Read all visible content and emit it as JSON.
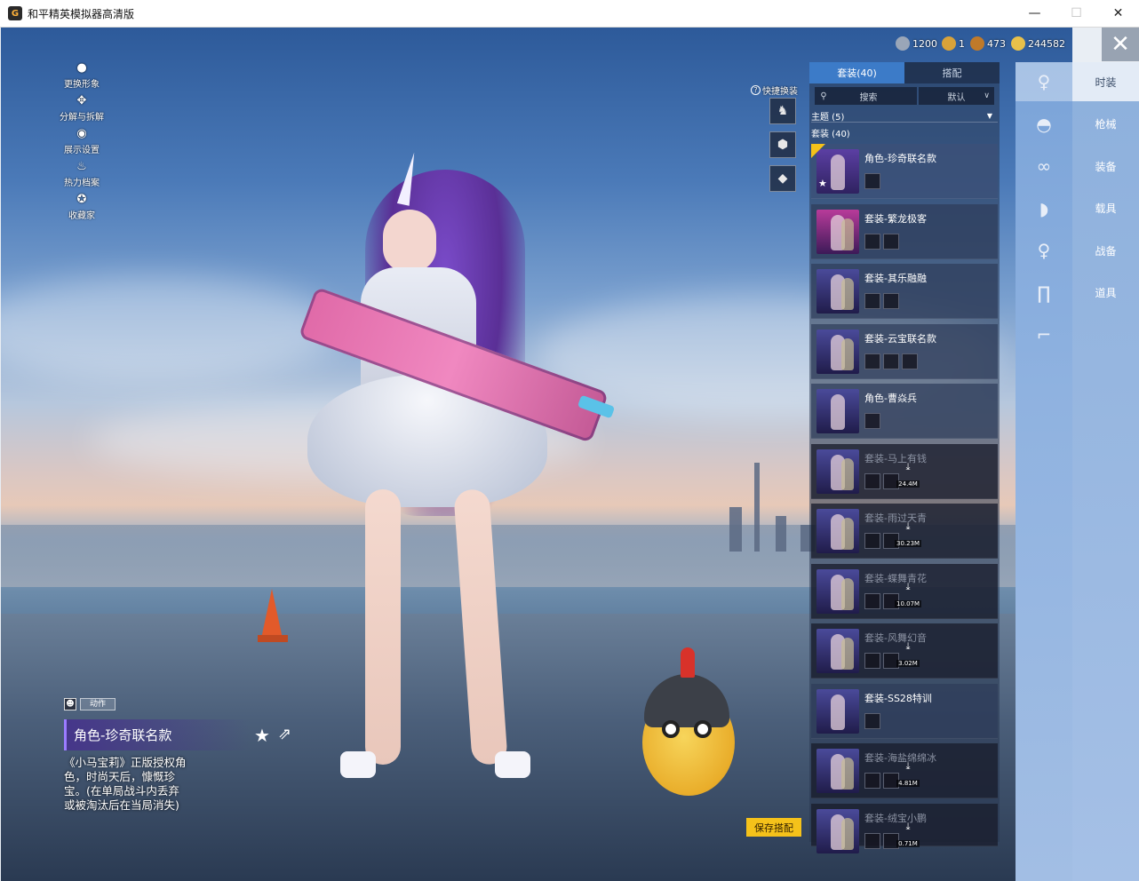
{
  "window": {
    "title": "和平精英模拟器高清版",
    "logo": "G",
    "minimize": "—",
    "maximize": "☐",
    "close": "✕"
  },
  "currency": [
    {
      "value": "1200",
      "color": "#9aa6b8"
    },
    {
      "value": "1",
      "color": "#d8a23a"
    },
    {
      "value": "473",
      "color": "#c07a2a"
    },
    {
      "value": "244582",
      "color": "#e8c04a"
    }
  ],
  "close_label": "✕",
  "left_menu": [
    {
      "label": "更换形象",
      "icon": "avatar-icon"
    },
    {
      "label": "分解与拆解",
      "icon": "puzzle-icon"
    },
    {
      "label": "展示设置",
      "icon": "eye-icon"
    },
    {
      "label": "热力档案",
      "icon": "fire-icon"
    },
    {
      "label": "收藏家",
      "icon": "collector-icon"
    }
  ],
  "quick_swap": {
    "label": "快捷换装",
    "help": "?"
  },
  "item_info": {
    "tag": "动作",
    "title": "角色-珍奇联名款",
    "description": "《小马宝莉》正版授权角色，时尚天后，慷慨珍宝。(在单局战斗内丢弃或被淘汰后在当局消失)"
  },
  "save_button": "保存搭配",
  "panel": {
    "tabs": [
      {
        "label": "套装(40)",
        "active": true
      },
      {
        "label": "搭配",
        "active": false
      }
    ],
    "search_placeholder": "搜索",
    "sort_label": "默认",
    "theme_label": "主题 (5)",
    "count_label": "套装 (40)",
    "items": [
      {
        "name": "角色-珍奇联名款",
        "locked": false,
        "selected": true,
        "subs": 1,
        "size": ""
      },
      {
        "name": "套装-繁龙极客",
        "locked": false,
        "selected": false,
        "subs": 2,
        "size": ""
      },
      {
        "name": "套装-其乐融融",
        "locked": false,
        "selected": false,
        "subs": 2,
        "size": ""
      },
      {
        "name": "套装-云宝联名款",
        "locked": false,
        "selected": false,
        "subs": 3,
        "size": ""
      },
      {
        "name": "角色-曹焱兵",
        "locked": false,
        "selected": false,
        "subs": 1,
        "size": ""
      },
      {
        "name": "套装-马上有钱",
        "locked": true,
        "selected": false,
        "subs": 2,
        "size": "24.4M"
      },
      {
        "name": "套装-雨过天青",
        "locked": true,
        "selected": false,
        "subs": 2,
        "size": "30.23M"
      },
      {
        "name": "套装-蝶舞青花",
        "locked": true,
        "selected": false,
        "subs": 2,
        "size": "10.07M"
      },
      {
        "name": "套装-风舞幻音",
        "locked": true,
        "selected": false,
        "subs": 2,
        "size": "3.02M"
      },
      {
        "name": "套装-SS28特训",
        "locked": false,
        "selected": false,
        "subs": 1,
        "size": ""
      },
      {
        "name": "套装-海盐绵绵冰",
        "locked": true,
        "selected": false,
        "subs": 2,
        "size": "4.81M"
      },
      {
        "name": "套装-绒宝小鹏",
        "locked": true,
        "selected": false,
        "subs": 2,
        "size": "0.71M"
      }
    ]
  },
  "categories": [
    {
      "icon": "character-icon",
      "glyph": "♀",
      "active": true
    },
    {
      "icon": "hat-icon",
      "glyph": "◓",
      "active": false
    },
    {
      "icon": "glasses-icon",
      "glyph": "∞",
      "active": false
    },
    {
      "icon": "mask-icon",
      "glyph": "◗",
      "active": false
    },
    {
      "icon": "outfit-icon",
      "glyph": "♀",
      "active": false
    },
    {
      "icon": "pants-icon",
      "glyph": "∏",
      "active": false
    },
    {
      "icon": "shoes-icon",
      "glyph": "⌐",
      "active": false
    }
  ],
  "nav": [
    {
      "label": "时装",
      "active": true
    },
    {
      "label": "枪械",
      "active": false
    },
    {
      "label": "装备",
      "active": false
    },
    {
      "label": "载具",
      "active": false
    },
    {
      "label": "战备",
      "active": false
    },
    {
      "label": "道具",
      "active": false
    }
  ]
}
